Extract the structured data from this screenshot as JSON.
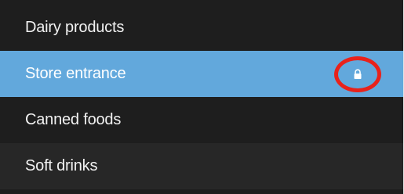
{
  "category_list": {
    "items": [
      {
        "label": "Dairy products",
        "selected": false,
        "locked": false
      },
      {
        "label": "Store entrance",
        "selected": true,
        "locked": true,
        "lock_icon": "lock-icon"
      },
      {
        "label": "Canned foods",
        "selected": false,
        "locked": false
      },
      {
        "label": "Soft drinks",
        "selected": false,
        "locked": false
      }
    ],
    "colors": {
      "background": "#1e1e1e",
      "alternate_row": "#272727",
      "selected_row": "#62a8dc",
      "text": "#f2f2f2",
      "highlight_ring": "#e8221b"
    }
  }
}
